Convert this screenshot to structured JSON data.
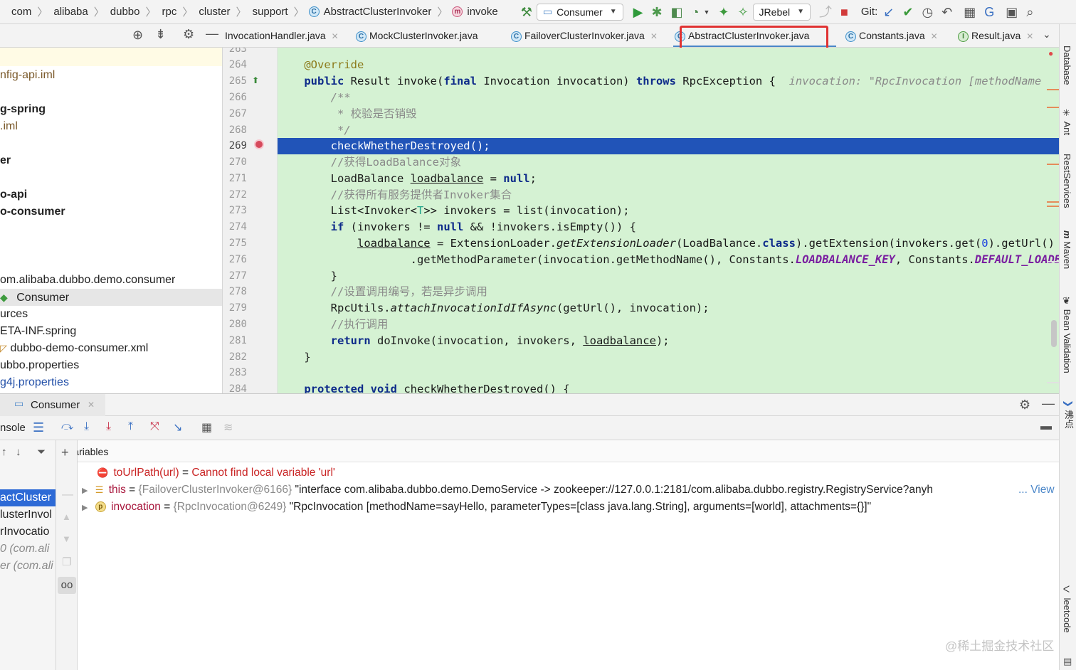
{
  "breadcrumb": {
    "items": [
      "com",
      "alibaba",
      "dubbo",
      "rpc",
      "cluster",
      "support"
    ],
    "class_item": "AbstractClusterInvoker",
    "method_item": "invoke"
  },
  "toolbar": {
    "run_config": "Consumer",
    "jrebel_config": "JRebel",
    "git_label": "Git:"
  },
  "tabs": [
    {
      "label": "InvocationHandler.java",
      "icon": "none",
      "active": false
    },
    {
      "label": "MockClusterInvoker.java",
      "icon": "C",
      "active": false
    },
    {
      "label": "FailoverClusterInvoker.java",
      "icon": "C",
      "active": false
    },
    {
      "label": "AbstractClusterInvoker.java",
      "icon": "C",
      "active": true
    },
    {
      "label": "Constants.java",
      "icon": "C",
      "active": false
    },
    {
      "label": "Result.java",
      "icon": "I",
      "active": false
    }
  ],
  "project_tree": [
    {
      "label": "nfig-api.iml",
      "style": "brown"
    },
    {
      "label": "g-spring",
      "style": "bold"
    },
    {
      "label": ".iml",
      "style": "brown"
    },
    {
      "label": "er",
      "style": "bold"
    },
    {
      "label": "o-api",
      "style": "bold"
    },
    {
      "label": "o-consumer",
      "style": "bold"
    },
    {
      "label": "om.alibaba.dubbo.demo.consumer",
      "style": "normal"
    },
    {
      "label": "Consumer",
      "style": "selected"
    },
    {
      "label": "urces",
      "style": "normal"
    },
    {
      "label": "ETA-INF.spring",
      "style": "normal"
    },
    {
      "label": "dubbo-demo-consumer.xml",
      "style": "normal"
    },
    {
      "label": "ubbo.properties",
      "style": "normal"
    },
    {
      "label": "g4j.properties",
      "style": "blue"
    }
  ],
  "editor": {
    "line_numbers": [
      "263",
      "264",
      "265",
      "266",
      "267",
      "268",
      "269",
      "270",
      "271",
      "272",
      "273",
      "274",
      "275",
      "276",
      "277",
      "278",
      "279",
      "280",
      "281",
      "282",
      "283",
      "284"
    ],
    "current_line": "269",
    "inline_hint": "invocation: \"RpcInvocation [methodName",
    "comments": {
      "c266": "/**",
      "c267": " * 校验是否销毁",
      "c268": " */",
      "c270": "//获得LoadBalance对象",
      "c272": "//获得所有服务提供者Invoker集合",
      "c278": "//设置调用编号，若是异步调用",
      "c280": "//执行调用"
    }
  },
  "debug": {
    "session_tab": "Consumer",
    "console_tab": "nsole",
    "variables_header": "Variables",
    "frames": [
      {
        "label": "actCluster",
        "style": "sel"
      },
      {
        "label": "lusterInvol",
        "style": "normal"
      },
      {
        "label": "rInvocatio",
        "style": "normal"
      },
      {
        "label": "0 (com.ali",
        "style": "grey"
      },
      {
        "label": "er (com.ali",
        "style": "grey"
      }
    ],
    "variables": [
      {
        "kind": "error",
        "name": "toUrlPath(url)",
        "eq": " = ",
        "value": "Cannot find local variable 'url'"
      },
      {
        "kind": "field",
        "name": "this",
        "eq": " = ",
        "type": "{FailoverClusterInvoker@6166}",
        "value": " \"interface com.alibaba.dubbo.demo.DemoService -> zookeeper://127.0.0.1:2181/com.alibaba.dubbo.registry.RegistryService?anyh",
        "suffix": "... View"
      },
      {
        "kind": "param",
        "name": "invocation",
        "eq": " = ",
        "type": "{RpcInvocation@6249}",
        "value": " \"RpcInvocation [methodName=sayHello, parameterTypes=[class java.lang.String], arguments=[world], attachments={}]\""
      }
    ]
  },
  "right_strip": [
    "Database",
    "Ant",
    "RestServices",
    "Maven",
    "Bean Validation",
    "沸点",
    "leetcode"
  ],
  "watermark": "@稀土掘金技术社区",
  "colors": {
    "code_background": "#d5f2d3",
    "execution_line": "#2154b8",
    "highlight_box": "#e03232",
    "selected_frame": "#2d6ad6"
  }
}
